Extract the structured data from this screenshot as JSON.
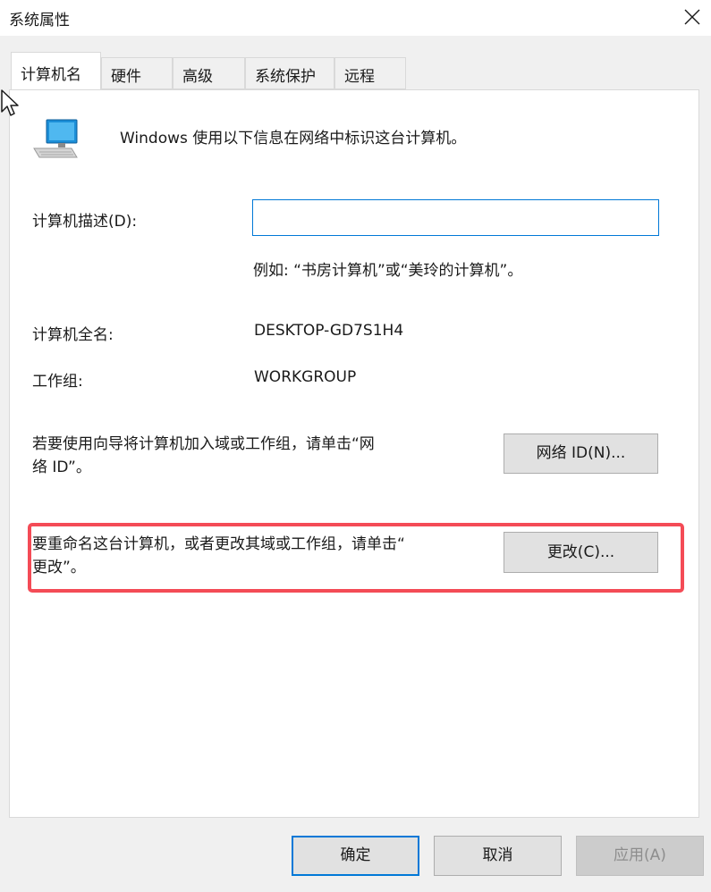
{
  "window": {
    "title": "系统属性"
  },
  "tabs": [
    {
      "label": "计算机名"
    },
    {
      "label": "硬件"
    },
    {
      "label": "高级"
    },
    {
      "label": "系统保护"
    },
    {
      "label": "远程"
    }
  ],
  "intro_text": "Windows 使用以下信息在网络中标识这台计算机。",
  "description": {
    "label": "计算机描述(D):",
    "value": "",
    "example": "例如: “书房计算机”或“美玲的计算机”。"
  },
  "full_name": {
    "label": "计算机全名:",
    "value": "DESKTOP-GD7S1H4"
  },
  "workgroup": {
    "label": "工作组:",
    "value": "WORKGROUP"
  },
  "network_id": {
    "text_line1": "若要使用向导将计算机加入域或工作组，请单击“网",
    "text_line2": "络 ID”。",
    "button_label": "网络 ID(N)..."
  },
  "rename": {
    "text_line1": "要重命名这台计算机，或者更改其域或工作组，请单击“",
    "text_line2": "更改”。",
    "button_label": "更改(C)..."
  },
  "footer": {
    "ok_label": "确定",
    "cancel_label": "取消",
    "apply_label": "应用(A)"
  },
  "colors": {
    "highlight_border": "#f44b56",
    "focus_blue": "#0078d7"
  },
  "icons": {
    "window_close": "close-icon",
    "computer": "computer-icon",
    "cursor": "mouse-pointer-icon"
  }
}
